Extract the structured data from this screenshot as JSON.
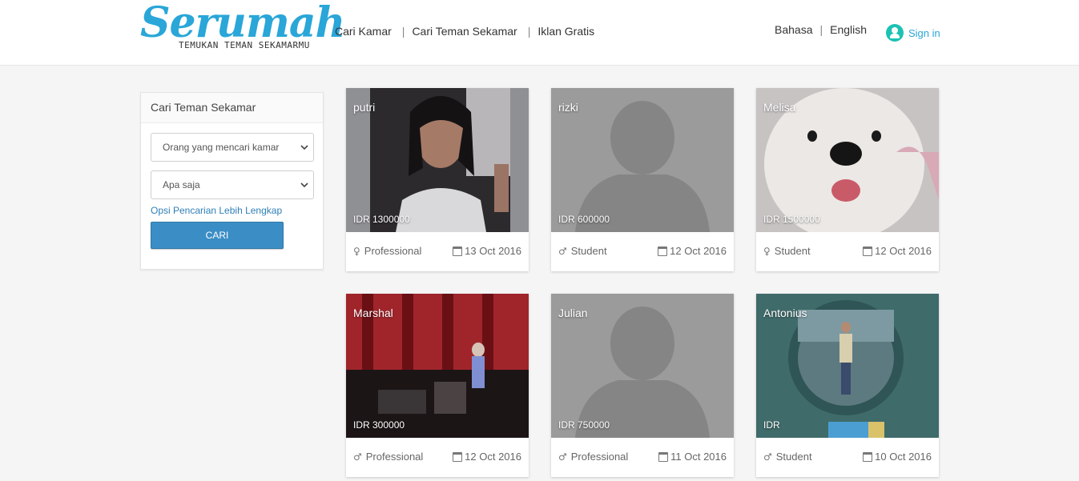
{
  "header": {
    "logo_word": "Serumah",
    "logo_tagline": "TEMUKAN TEMAN SEKAMARMU",
    "nav": [
      "Cari Kamar",
      "Cari Teman Sekamar",
      "Iklan Gratis"
    ],
    "languages": [
      "Bahasa",
      "English"
    ],
    "signin_label": "Sign in"
  },
  "sidebar": {
    "title": "Cari Teman Sekamar",
    "select1_value": "Orang yang mencari kamar",
    "select2_value": "Apa saja",
    "advanced_link": "Opsi Pencarian Lebih Lengkap",
    "search_button": "CARI"
  },
  "listings": [
    {
      "name": "putri",
      "price": "IDR 1300000",
      "gender": "female",
      "occupation": "Professional",
      "date": "13 Oct 2016"
    },
    {
      "name": "rizki",
      "price": "IDR 600000",
      "gender": "male",
      "occupation": "Student",
      "date": "12 Oct 2016"
    },
    {
      "name": "Melisa",
      "price": "IDR 1500000",
      "gender": "female",
      "occupation": "Student",
      "date": "12 Oct 2016"
    },
    {
      "name": "Marshal",
      "price": "IDR 300000",
      "gender": "male",
      "occupation": "Professional",
      "date": "12 Oct 2016"
    },
    {
      "name": "Julian",
      "price": "IDR 750000",
      "gender": "male",
      "occupation": "Professional",
      "date": "11 Oct 2016"
    },
    {
      "name": "Antonius",
      "price": "IDR",
      "gender": "male",
      "occupation": "Student",
      "date": "10 Oct 2016"
    }
  ],
  "colors": {
    "brand": "#2aa6d8",
    "button": "#3b8ec5",
    "signin_icon": "#1dc2b4",
    "link": "#2f7fb5"
  }
}
